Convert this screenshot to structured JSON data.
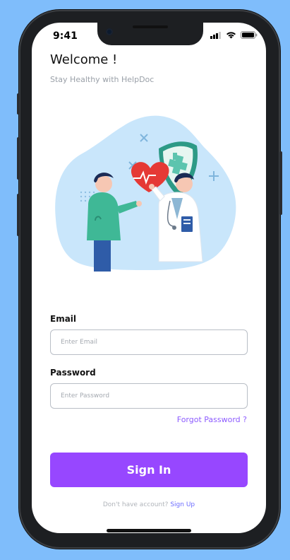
{
  "status": {
    "time": "9:41"
  },
  "header": {
    "title": "Welcome !",
    "subtitle": "Stay Healthy with HelpDoc"
  },
  "form": {
    "email_label": "Email",
    "email_placeholder": "Enter Email",
    "password_label": "Password",
    "password_placeholder": "Enter Password",
    "forgot_label": "Forgot Password ?",
    "signin_label": "Sign In"
  },
  "footer": {
    "prompt": "Don't have account?",
    "signup_label": "Sign Up"
  },
  "colors": {
    "background": "#7fbdfb",
    "primary": "#9747ff",
    "link": "#8d5cff"
  },
  "icons": {
    "signal": "signal-icon",
    "wifi": "wifi-icon",
    "battery": "battery-icon"
  }
}
